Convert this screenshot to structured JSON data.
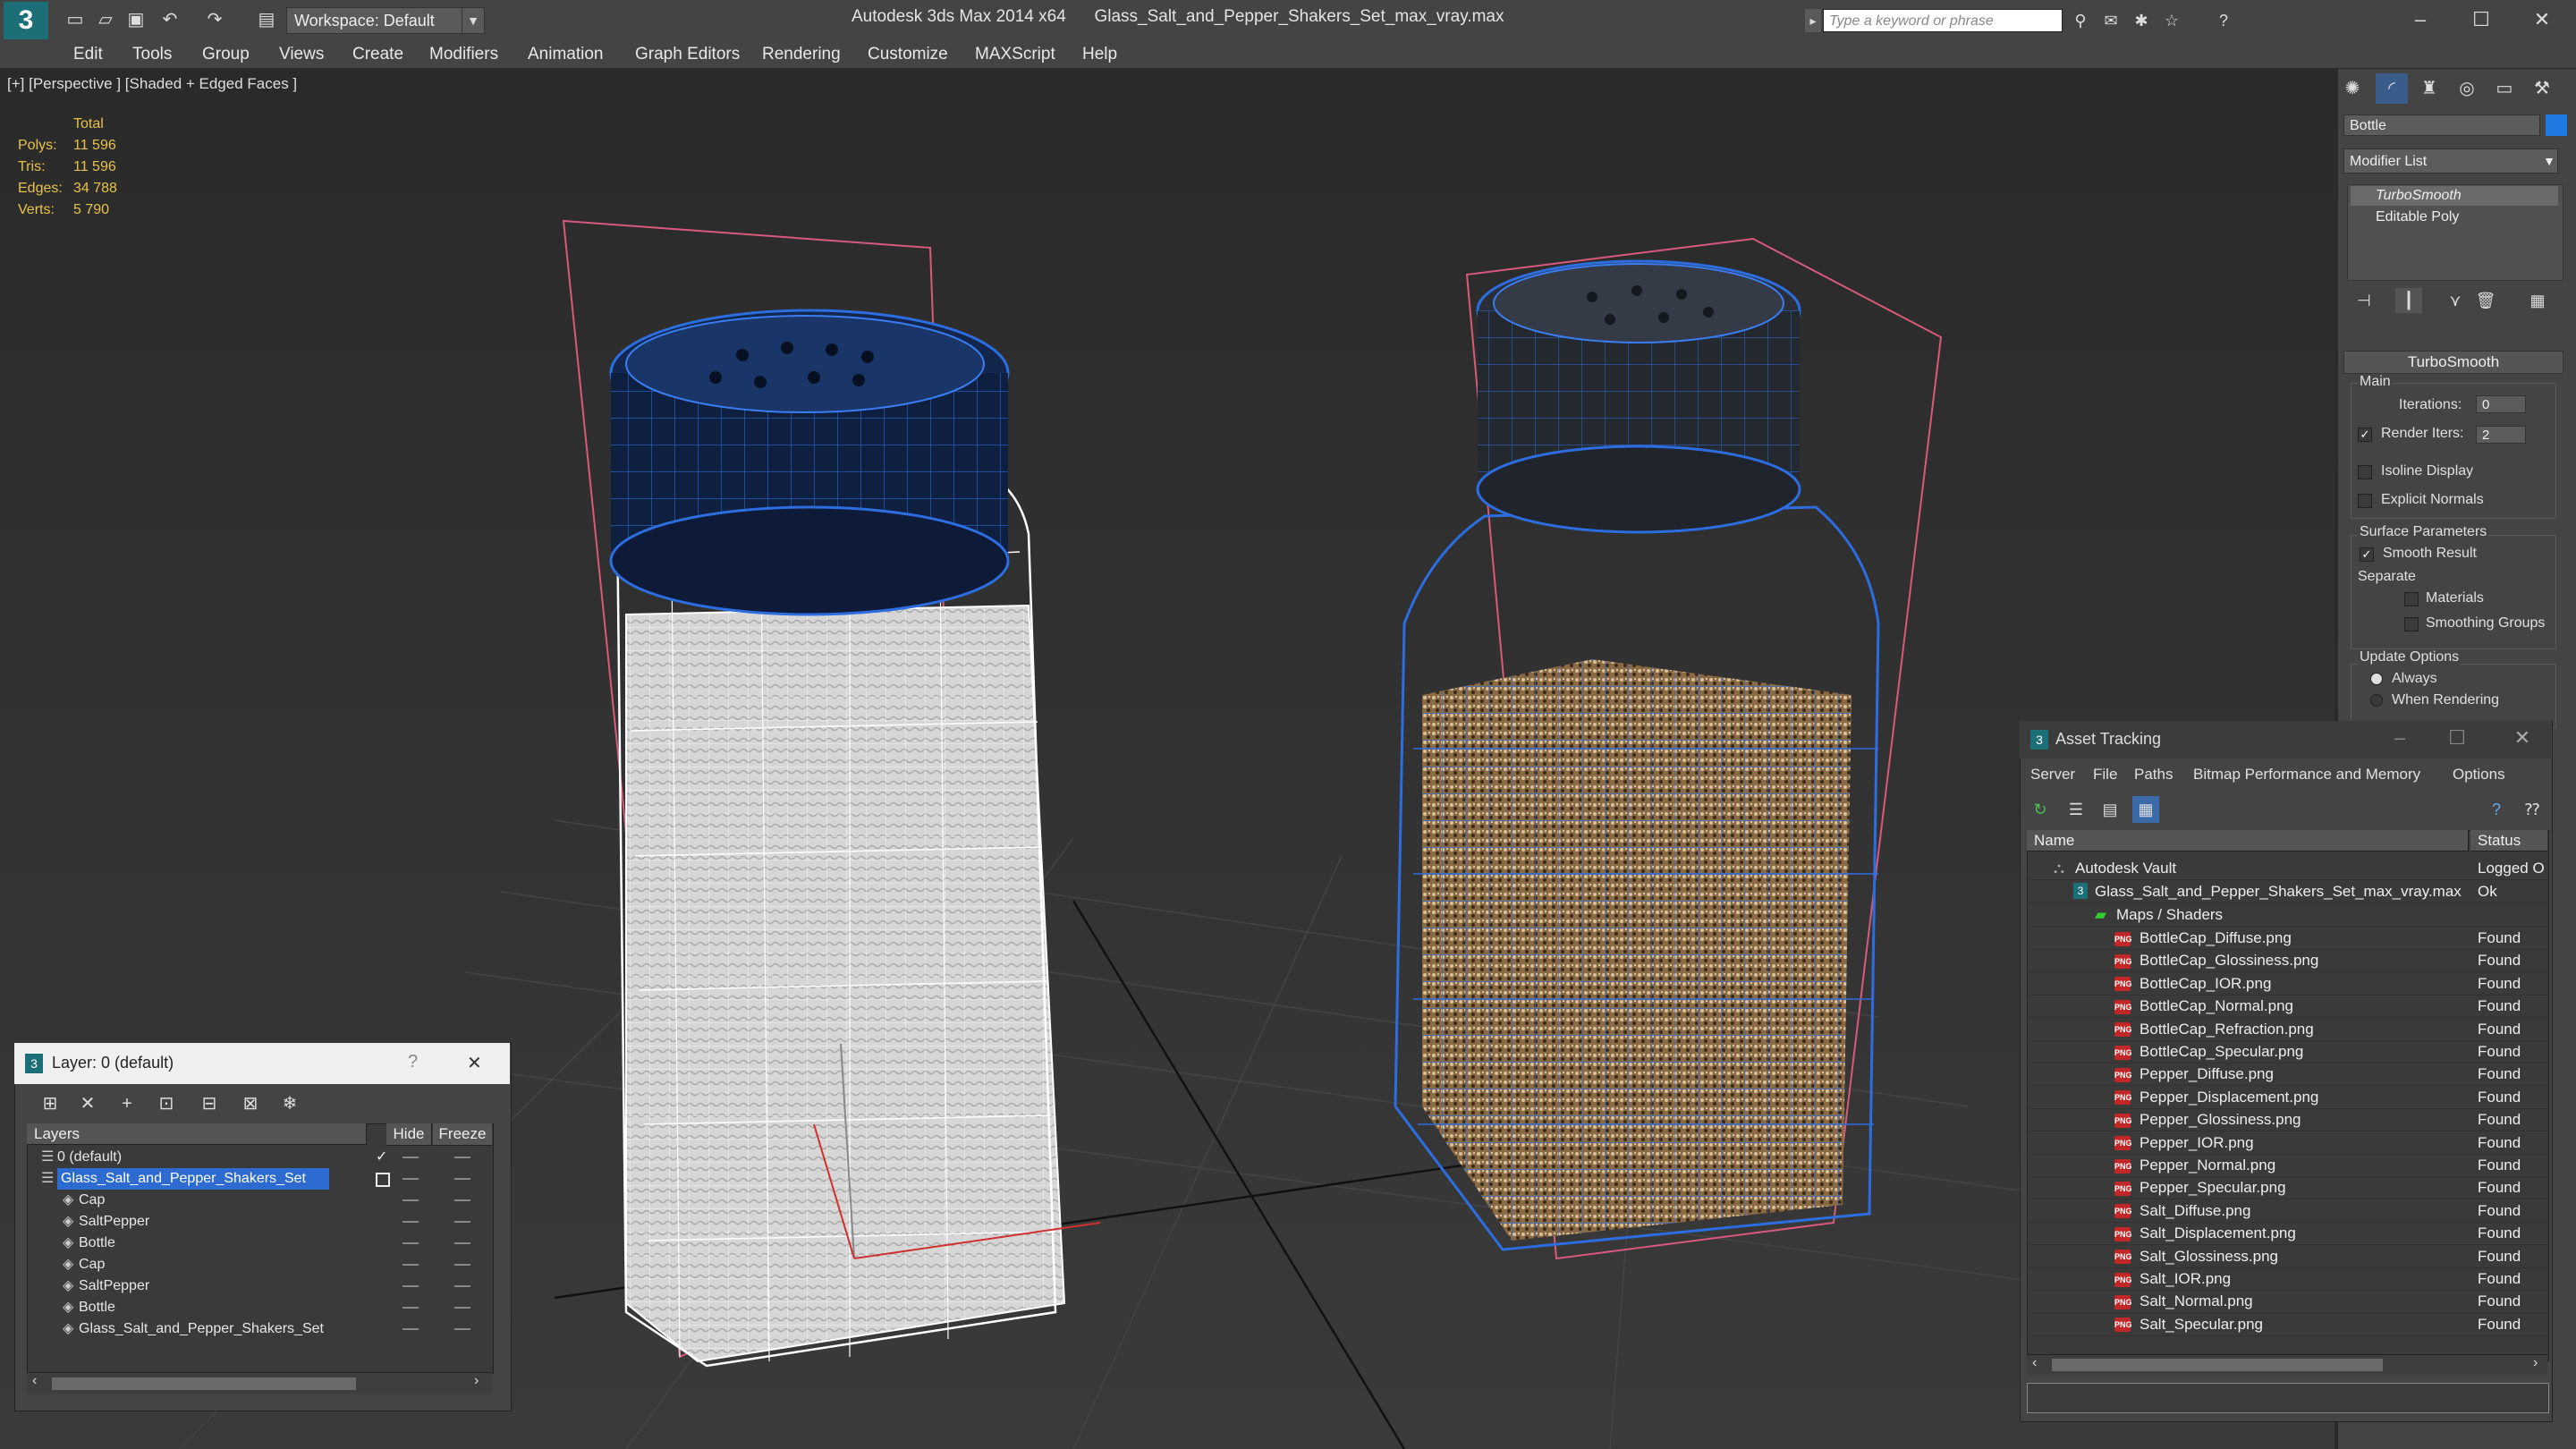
{
  "app": {
    "title": "Autodesk 3ds Max 2014 x64",
    "file": "Glass_Salt_and_Pepper_Shakers_Set_max_vray.max",
    "workspace": "Workspace: Default",
    "search_placeholder": "Type a keyword or phrase"
  },
  "menu": [
    "Edit",
    "Tools",
    "Group",
    "Views",
    "Create",
    "Modifiers",
    "Animation",
    "Graph Editors",
    "Rendering",
    "Customize",
    "MAXScript",
    "Help"
  ],
  "viewport": {
    "label": "[+] [Perspective ] [Shaded + Edged Faces ]",
    "stats": {
      "header": "Total",
      "rows": [
        {
          "label": "Polys:",
          "value": "11 596"
        },
        {
          "label": "Tris:",
          "value": "11 596"
        },
        {
          "label": "Edges:",
          "value": "34 788"
        },
        {
          "label": "Verts:",
          "value": "5 790"
        }
      ]
    }
  },
  "command_panel": {
    "object_name": "Bottle",
    "modifier_list": "Modifier List",
    "stack": [
      "TurboSmooth",
      "Editable Poly"
    ],
    "rollout": "TurboSmooth",
    "main": "Main",
    "iterations_label": "Iterations:",
    "iterations": "0",
    "render_iters_label": "Render Iters:",
    "render_iters": "2",
    "isoline": "Isoline Display",
    "explicit_normals": "Explicit Normals",
    "surface_params": "Surface Parameters",
    "smooth_result": "Smooth Result",
    "separate": "Separate",
    "materials": "Materials",
    "smoothing_groups": "Smoothing Groups",
    "update_options": "Update Options",
    "always": "Always",
    "when_rendering": "When Rendering"
  },
  "asset_tracking": {
    "title": "Asset Tracking",
    "menu": [
      "Server",
      "File",
      "Paths",
      "Bitmap Performance and Memory",
      "Options"
    ],
    "col_name": "Name",
    "col_status": "Status",
    "vault": {
      "name": "Autodesk Vault",
      "status": "Logged O"
    },
    "file": {
      "name": "Glass_Salt_and_Pepper_Shakers_Set_max_vray.max",
      "status": "Ok"
    },
    "folder": "Maps / Shaders",
    "maps": [
      {
        "name": "BottleCap_Diffuse.png",
        "status": "Found"
      },
      {
        "name": "BottleCap_Glossiness.png",
        "status": "Found"
      },
      {
        "name": "BottleCap_IOR.png",
        "status": "Found"
      },
      {
        "name": "BottleCap_Normal.png",
        "status": "Found"
      },
      {
        "name": "BottleCap_Refraction.png",
        "status": "Found"
      },
      {
        "name": "BottleCap_Specular.png",
        "status": "Found"
      },
      {
        "name": "Pepper_Diffuse.png",
        "status": "Found"
      },
      {
        "name": "Pepper_Displacement.png",
        "status": "Found"
      },
      {
        "name": "Pepper_Glossiness.png",
        "status": "Found"
      },
      {
        "name": "Pepper_IOR.png",
        "status": "Found"
      },
      {
        "name": "Pepper_Normal.png",
        "status": "Found"
      },
      {
        "name": "Pepper_Specular.png",
        "status": "Found"
      },
      {
        "name": "Salt_Diffuse.png",
        "status": "Found"
      },
      {
        "name": "Salt_Displacement.png",
        "status": "Found"
      },
      {
        "name": "Salt_Glossiness.png",
        "status": "Found"
      },
      {
        "name": "Salt_IOR.png",
        "status": "Found"
      },
      {
        "name": "Salt_Normal.png",
        "status": "Found"
      },
      {
        "name": "Salt_Specular.png",
        "status": "Found"
      }
    ]
  },
  "layer_panel": {
    "title": "Layer: 0 (default)",
    "col_layers": "Layers",
    "col_hide": "Hide",
    "col_freeze": "Freeze",
    "rows": [
      {
        "name": "0 (default)"
      },
      {
        "name": "Glass_Salt_and_Pepper_Shakers_Set"
      },
      {
        "name": "Cap"
      },
      {
        "name": "SaltPepper"
      },
      {
        "name": "Bottle"
      },
      {
        "name": "Cap"
      },
      {
        "name": "SaltPepper"
      },
      {
        "name": "Bottle"
      },
      {
        "name": "Glass_Salt_and_Pepper_Shakers_Set"
      }
    ]
  }
}
